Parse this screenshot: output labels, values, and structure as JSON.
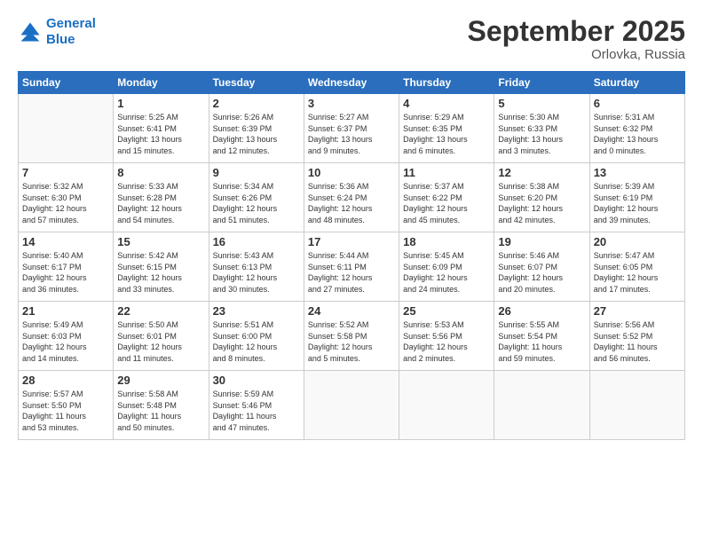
{
  "logo": {
    "line1": "General",
    "line2": "Blue"
  },
  "title": "September 2025",
  "location": "Orlovka, Russia",
  "weekdays": [
    "Sunday",
    "Monday",
    "Tuesday",
    "Wednesday",
    "Thursday",
    "Friday",
    "Saturday"
  ],
  "weeks": [
    [
      {
        "day": "",
        "info": ""
      },
      {
        "day": "1",
        "info": "Sunrise: 5:25 AM\nSunset: 6:41 PM\nDaylight: 13 hours\nand 15 minutes."
      },
      {
        "day": "2",
        "info": "Sunrise: 5:26 AM\nSunset: 6:39 PM\nDaylight: 13 hours\nand 12 minutes."
      },
      {
        "day": "3",
        "info": "Sunrise: 5:27 AM\nSunset: 6:37 PM\nDaylight: 13 hours\nand 9 minutes."
      },
      {
        "day": "4",
        "info": "Sunrise: 5:29 AM\nSunset: 6:35 PM\nDaylight: 13 hours\nand 6 minutes."
      },
      {
        "day": "5",
        "info": "Sunrise: 5:30 AM\nSunset: 6:33 PM\nDaylight: 13 hours\nand 3 minutes."
      },
      {
        "day": "6",
        "info": "Sunrise: 5:31 AM\nSunset: 6:32 PM\nDaylight: 13 hours\nand 0 minutes."
      }
    ],
    [
      {
        "day": "7",
        "info": "Sunrise: 5:32 AM\nSunset: 6:30 PM\nDaylight: 12 hours\nand 57 minutes."
      },
      {
        "day": "8",
        "info": "Sunrise: 5:33 AM\nSunset: 6:28 PM\nDaylight: 12 hours\nand 54 minutes."
      },
      {
        "day": "9",
        "info": "Sunrise: 5:34 AM\nSunset: 6:26 PM\nDaylight: 12 hours\nand 51 minutes."
      },
      {
        "day": "10",
        "info": "Sunrise: 5:36 AM\nSunset: 6:24 PM\nDaylight: 12 hours\nand 48 minutes."
      },
      {
        "day": "11",
        "info": "Sunrise: 5:37 AM\nSunset: 6:22 PM\nDaylight: 12 hours\nand 45 minutes."
      },
      {
        "day": "12",
        "info": "Sunrise: 5:38 AM\nSunset: 6:20 PM\nDaylight: 12 hours\nand 42 minutes."
      },
      {
        "day": "13",
        "info": "Sunrise: 5:39 AM\nSunset: 6:19 PM\nDaylight: 12 hours\nand 39 minutes."
      }
    ],
    [
      {
        "day": "14",
        "info": "Sunrise: 5:40 AM\nSunset: 6:17 PM\nDaylight: 12 hours\nand 36 minutes."
      },
      {
        "day": "15",
        "info": "Sunrise: 5:42 AM\nSunset: 6:15 PM\nDaylight: 12 hours\nand 33 minutes."
      },
      {
        "day": "16",
        "info": "Sunrise: 5:43 AM\nSunset: 6:13 PM\nDaylight: 12 hours\nand 30 minutes."
      },
      {
        "day": "17",
        "info": "Sunrise: 5:44 AM\nSunset: 6:11 PM\nDaylight: 12 hours\nand 27 minutes."
      },
      {
        "day": "18",
        "info": "Sunrise: 5:45 AM\nSunset: 6:09 PM\nDaylight: 12 hours\nand 24 minutes."
      },
      {
        "day": "19",
        "info": "Sunrise: 5:46 AM\nSunset: 6:07 PM\nDaylight: 12 hours\nand 20 minutes."
      },
      {
        "day": "20",
        "info": "Sunrise: 5:47 AM\nSunset: 6:05 PM\nDaylight: 12 hours\nand 17 minutes."
      }
    ],
    [
      {
        "day": "21",
        "info": "Sunrise: 5:49 AM\nSunset: 6:03 PM\nDaylight: 12 hours\nand 14 minutes."
      },
      {
        "day": "22",
        "info": "Sunrise: 5:50 AM\nSunset: 6:01 PM\nDaylight: 12 hours\nand 11 minutes."
      },
      {
        "day": "23",
        "info": "Sunrise: 5:51 AM\nSunset: 6:00 PM\nDaylight: 12 hours\nand 8 minutes."
      },
      {
        "day": "24",
        "info": "Sunrise: 5:52 AM\nSunset: 5:58 PM\nDaylight: 12 hours\nand 5 minutes."
      },
      {
        "day": "25",
        "info": "Sunrise: 5:53 AM\nSunset: 5:56 PM\nDaylight: 12 hours\nand 2 minutes."
      },
      {
        "day": "26",
        "info": "Sunrise: 5:55 AM\nSunset: 5:54 PM\nDaylight: 11 hours\nand 59 minutes."
      },
      {
        "day": "27",
        "info": "Sunrise: 5:56 AM\nSunset: 5:52 PM\nDaylight: 11 hours\nand 56 minutes."
      }
    ],
    [
      {
        "day": "28",
        "info": "Sunrise: 5:57 AM\nSunset: 5:50 PM\nDaylight: 11 hours\nand 53 minutes."
      },
      {
        "day": "29",
        "info": "Sunrise: 5:58 AM\nSunset: 5:48 PM\nDaylight: 11 hours\nand 50 minutes."
      },
      {
        "day": "30",
        "info": "Sunrise: 5:59 AM\nSunset: 5:46 PM\nDaylight: 11 hours\nand 47 minutes."
      },
      {
        "day": "",
        "info": ""
      },
      {
        "day": "",
        "info": ""
      },
      {
        "day": "",
        "info": ""
      },
      {
        "day": "",
        "info": ""
      }
    ]
  ]
}
